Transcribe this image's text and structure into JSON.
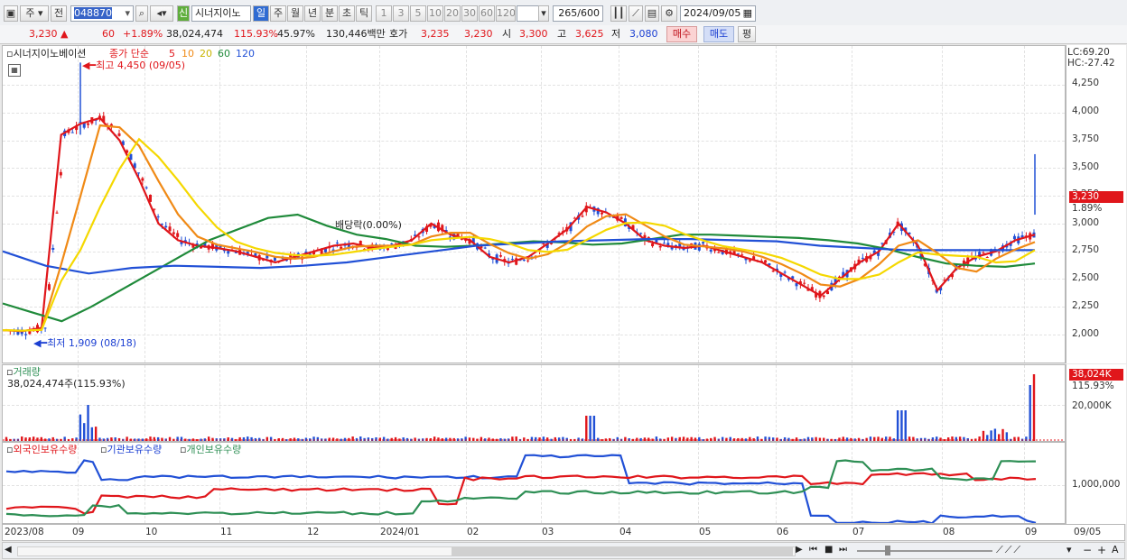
{
  "toolbar": {
    "market": "주",
    "mode": "전",
    "code": "048870",
    "name": "시너지이노",
    "tag": "신",
    "periods": [
      "일",
      "주",
      "월",
      "년",
      "분",
      "초",
      "틱"
    ],
    "minutes": [
      "1",
      "3",
      "5",
      "10",
      "20",
      "30",
      "60",
      "120"
    ],
    "count": "265",
    "total": "/600",
    "date": "2024/09/05"
  },
  "quote": {
    "price": "3,230",
    "change": "60",
    "pct": "+1.89%",
    "volume": "38,024,474",
    "vol_ratio": "115.93%",
    "turnover_pct": "45.97%",
    "amount": "130,446백만",
    "hoga_label": "호가",
    "hoga_ask": "3,235",
    "hoga_bid": "3,230",
    "open_label": "시",
    "open": "3,300",
    "high_label": "고",
    "high": "3,625",
    "low_label": "저",
    "low": "3,080",
    "buy": "매수",
    "sell": "매도",
    "eval": "평"
  },
  "price_panel": {
    "title": "시너지이노베이션",
    "ma_label": "종가 단순",
    "ma": [
      {
        "p": "5",
        "color": "#e0161b"
      },
      {
        "p": "10",
        "color": "#f08a16"
      },
      {
        "p": "20",
        "color": "#f5d800"
      },
      {
        "p": "60",
        "color": "#1f8a3a"
      },
      {
        "p": "120",
        "color": "#2150d6"
      }
    ],
    "lc": "LC:69.20",
    "hc": "HC:-27.42",
    "high_note": "최고 4,450 (09/05)",
    "low_note": "최저 1,909 (08/18)",
    "dividend": "배당락(0.00%)",
    "last_price": "3,230",
    "last_pct": "1.89%",
    "yticks": [
      "4,250",
      "4,000",
      "3,750",
      "3,500",
      "3,250",
      "3,000",
      "2,750",
      "2,500",
      "2,250",
      "2,000"
    ]
  },
  "volume_panel": {
    "title": "거래량",
    "value": "38,024,474주(115.93%)",
    "last": "38,024K",
    "last_pct": "115.93%",
    "ytick": "20,000K"
  },
  "holdings_panel": {
    "legend": [
      {
        "label": "외국인보유수량",
        "color": "#e0161b"
      },
      {
        "label": "기관보유수량",
        "color": "#2150d6"
      },
      {
        "label": "개인보유수량",
        "color": "#2e8f55"
      }
    ],
    "ytick": "1,000,000"
  },
  "xaxis": [
    "2023/08",
    "09",
    "10",
    "11",
    "12",
    "2024/01",
    "02",
    "03",
    "04",
    "05",
    "06",
    "07",
    "08",
    "09",
    "09/05"
  ],
  "chart_data": {
    "type": "line",
    "x_start": "2023/08",
    "x_end": "2024/09/05",
    "ylim": [
      1900,
      4450
    ],
    "last_close": 3230,
    "high": {
      "value": 4450,
      "date": "09/05"
    },
    "low": {
      "value": 1909,
      "date": "08/18"
    },
    "series": [
      {
        "name": "종가 단순 5",
        "values": [
          2040,
          2030,
          2060,
          3800,
          3900,
          3950,
          3750,
          3400,
          3000,
          2850,
          2800,
          2780,
          2750,
          2700,
          2650,
          2700,
          2750,
          2800,
          2820,
          2780,
          2800,
          2850,
          3000,
          2900,
          2850,
          2700,
          2650,
          2700,
          2820,
          2950,
          3150,
          3100,
          3000,
          2850,
          2800,
          2780,
          2800,
          2750,
          2700,
          2650,
          2550,
          2450,
          2350,
          2500,
          2650,
          2750,
          3000,
          2800,
          2400,
          2600,
          2700,
          2750,
          2850,
          2900
        ]
      },
      {
        "name": "종가 단순 60",
        "values": [
          2280,
          2200,
          2120,
          2250,
          2400,
          2550,
          2700,
          2850,
          2950,
          3050,
          3080,
          2980,
          2900,
          2860,
          2800,
          2790,
          2800,
          2820,
          2840,
          2830,
          2810,
          2820,
          2860,
          2900,
          2900,
          2890,
          2880,
          2870,
          2850,
          2820,
          2770,
          2700,
          2640,
          2620,
          2610,
          2640
        ]
      },
      {
        "name": "종가 단순 120",
        "values": [
          2750,
          2620,
          2550,
          2600,
          2620,
          2610,
          2600,
          2620,
          2650,
          2700,
          2750,
          2800,
          2820,
          2840,
          2850,
          2860,
          2860,
          2850,
          2840,
          2800,
          2780,
          2760,
          2760,
          2760,
          2760
        ]
      }
    ]
  }
}
